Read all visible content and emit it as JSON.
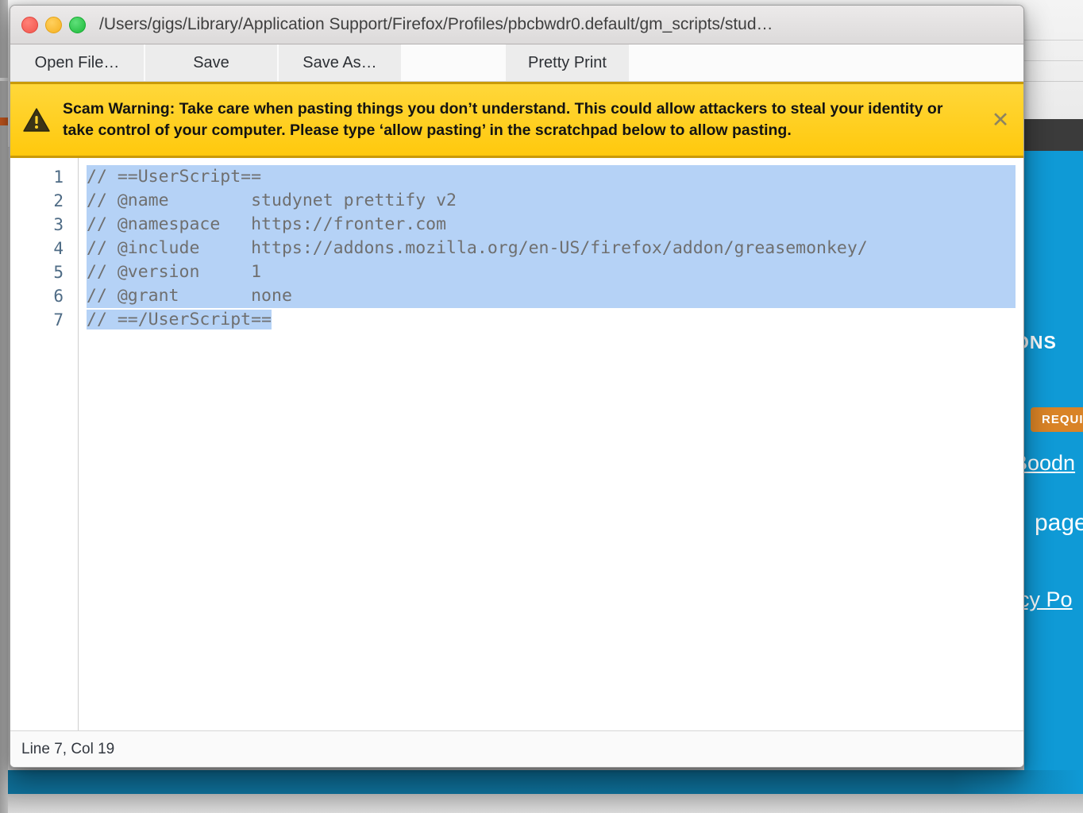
{
  "window": {
    "title": "/Users/gigs/Library/Application Support/Firefox/Profiles/pbcbwdr0.default/gm_scripts/stud…",
    "traffic_lights": {
      "close_color": "#ff6058",
      "minimize_color": "#ffbd2e",
      "maximize_color": "#28c840"
    }
  },
  "toolbar": {
    "open_file_label": "Open File…",
    "save_label": "Save",
    "save_as_label": "Save As…",
    "pretty_print_label": "Pretty Print"
  },
  "warning": {
    "icon": "warning-triangle-icon",
    "text": "Scam Warning: Take care when pasting things you don’t understand. This could allow attackers to steal your identity or take control of your computer. Please type ‘allow pasting’ in the scratchpad below to allow pasting.",
    "close_label": "✕",
    "background_color": "#ffd12a",
    "border_color": "#c99a08"
  },
  "editor": {
    "line_numbers": [
      "1",
      "2",
      "3",
      "4",
      "5",
      "6",
      "7"
    ],
    "lines": [
      "// ==UserScript==",
      "// @name        studynet prettify v2",
      "// @namespace   https://fronter.com",
      "// @include     https://addons.mozilla.org/en-US/firefox/addon/greasemonkey/",
      "// @version     1",
      "// @grant       none",
      "// ==/UserScript=="
    ],
    "selection_color": "#b5d2f6",
    "text_color": "#6f6f6f"
  },
  "statusbar": {
    "position_label": "Line 7, Col 19"
  },
  "background_page": {
    "extensions_heading": "ONS",
    "required_badge": "REQUI",
    "author_link": "Boodn",
    "page_text": "page",
    "privacy_link": "acy Po",
    "accent_color": "#0f9ad6",
    "badge_color": "#d98326"
  }
}
